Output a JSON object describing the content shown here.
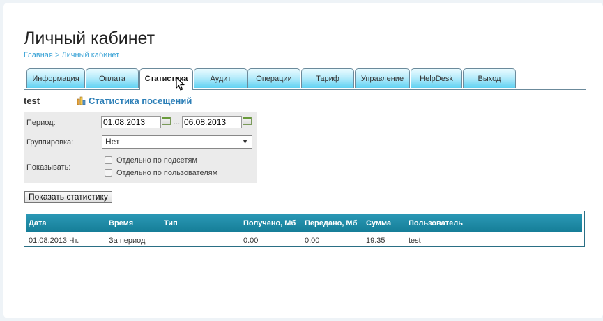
{
  "page": {
    "title": "Личный кабинет",
    "breadcrumb": {
      "home": "Главная",
      "separator": ">",
      "current": "Личный кабинет"
    }
  },
  "tabs": [
    {
      "label": "Информация"
    },
    {
      "label": "Оплата"
    },
    {
      "label": "Статистика",
      "active": true
    },
    {
      "label": "Аудит"
    },
    {
      "label": "Операции"
    },
    {
      "label": "Тариф"
    },
    {
      "label": "Управление"
    },
    {
      "label": "HelpDesk"
    },
    {
      "label": "Выход"
    }
  ],
  "user": {
    "name": "test"
  },
  "links": {
    "visit_stats": "Статистика посещений"
  },
  "filters": {
    "period_label": "Период:",
    "date_from": "01.08.2013",
    "range_separator": "...",
    "date_to": "06.08.2013",
    "grouping_label": "Группировка:",
    "grouping_value": "Нет",
    "show_label": "Показывать:",
    "by_subnets_label": "Отдельно по подсетям",
    "by_subnets_checked": false,
    "by_users_label": "Отдельно по пользователям",
    "by_users_checked": false
  },
  "buttons": {
    "show_stats": "Показать статистику"
  },
  "table": {
    "columns": [
      "Дата",
      "Время",
      "Тип",
      "Получено, Мб",
      "Передано, Мб",
      "Сумма",
      "Пользователь"
    ],
    "rows": [
      [
        "01.08.2013 Чт.",
        "За период",
        "",
        "0.00",
        "0.00",
        "19.35",
        "test"
      ]
    ]
  },
  "colors": {
    "accent": "#3aa3d6",
    "tab_gradient_bottom": "#5fd1f2",
    "table_header": "#1f8aa7",
    "link": "#2d7fb7"
  }
}
